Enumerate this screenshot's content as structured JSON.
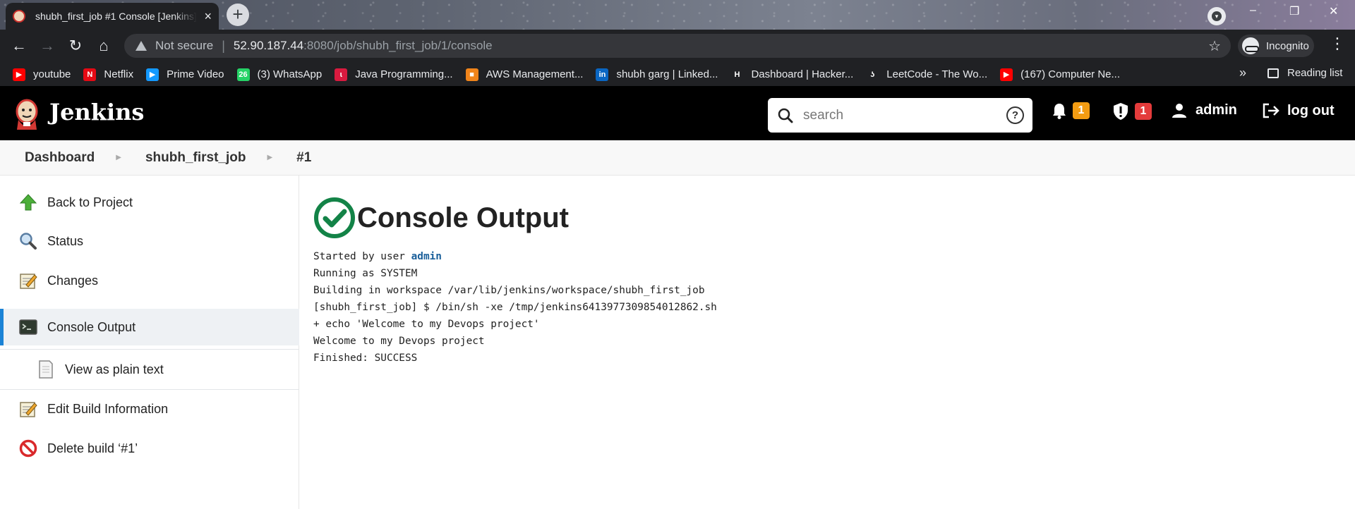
{
  "browser": {
    "tab_title": "shubh_first_job #1 Console [Jenkins]",
    "tab_close": "×",
    "new_tab": "+",
    "not_secure": "Not secure",
    "url_host": "52.90.187.44",
    "url_rest": ":8080/job/shubh_first_job/1/console",
    "incognito_label": "Incognito",
    "reading_list": "Reading list",
    "bookmarks_more": "»",
    "bookmarks": [
      {
        "label": "youtube",
        "icon": "youtube-icon",
        "color": "#ff0000",
        "glyph": "▶"
      },
      {
        "label": "Netflix",
        "icon": "netflix-icon",
        "color": "#e50914",
        "glyph": "N"
      },
      {
        "label": "Prime Video",
        "icon": "prime-video-icon",
        "color": "#1399ff",
        "glyph": "▶"
      },
      {
        "label": "(3) WhatsApp",
        "icon": "whatsapp-icon",
        "color": "#25d366",
        "glyph": "26"
      },
      {
        "label": "Java Programming...",
        "icon": "java-icon",
        "color": "#d91a3f",
        "glyph": "ɩ"
      },
      {
        "label": "AWS Management...",
        "icon": "aws-icon",
        "color": "#f0841a",
        "glyph": "■"
      },
      {
        "label": "shubh garg | Linked...",
        "icon": "linkedin-icon",
        "color": "#0a66c2",
        "glyph": "in"
      },
      {
        "label": "Dashboard | Hacker...",
        "icon": "hackerrank-icon",
        "color": "#202124",
        "glyph": "H"
      },
      {
        "label": "LeetCode - The Wo...",
        "icon": "leetcode-icon",
        "color": "#202124",
        "glyph": "ʖ"
      },
      {
        "label": "(167) Computer Ne...",
        "icon": "youtube-icon",
        "color": "#ff0000",
        "glyph": "▶"
      }
    ]
  },
  "jenkins": {
    "title": "Jenkins",
    "search_placeholder": "search",
    "help": "?",
    "notifications_count": "1",
    "security_count": "1",
    "user": "admin",
    "logout": "log out"
  },
  "breadcrumbs": [
    "Dashboard",
    "shubh_first_job",
    "#1"
  ],
  "sidebar": [
    {
      "label": "Back to Project",
      "icon": "up-arrow-icon"
    },
    {
      "label": "Status",
      "icon": "magnifier-icon"
    },
    {
      "label": "Changes",
      "icon": "notepad-icon"
    },
    {
      "label": "Console Output",
      "icon": "terminal-icon"
    },
    {
      "label": "View as plain text",
      "icon": "document-icon"
    },
    {
      "label": "Edit Build Information",
      "icon": "notepad-icon"
    },
    {
      "label": "Delete build ‘#1’",
      "icon": "no-entry-icon"
    }
  ],
  "main": {
    "heading": "Console Output",
    "status_color": "#138347",
    "console": {
      "started_prefix": "Started by user ",
      "started_user": "admin",
      "lines": [
        "Running as SYSTEM",
        "Building in workspace /var/lib/jenkins/workspace/shubh_first_job",
        "[shubh_first_job] $ /bin/sh -xe /tmp/jenkins6413977309854012862.sh",
        "+ echo 'Welcome to my Devops project'",
        "Welcome to my Devops project",
        "Finished: SUCCESS"
      ]
    }
  }
}
